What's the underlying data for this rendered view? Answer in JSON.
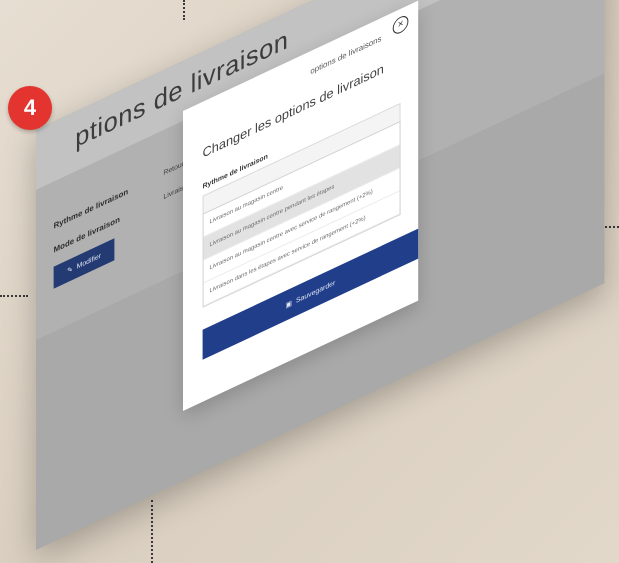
{
  "badge": {
    "number": "4"
  },
  "page": {
    "title": "ptions de livraison",
    "shipping_rhythm_label": "Rythme de livraison",
    "delivery_mode_label": "Mode de livraison",
    "rhythm_value": "Retour",
    "mode_value": "Livraison au magasin",
    "change_button": "Modifier"
  },
  "modal": {
    "subtitle": "options de livraisons",
    "title": "Changer les options de livraison",
    "field_label": "Rythme de livraison",
    "options": [
      "Livraison au magasin centre",
      "Livraison au magasin centre pendant les étapes",
      "Livraison au magasin centre avec service de rangement (+2%)",
      "Livraison dans les étapes avec service de rangement (+2%)"
    ],
    "selected_index": 1,
    "submit_button": "Sauvegarder"
  },
  "colors": {
    "badge": "#e3342f",
    "primary_button": "#213e8b",
    "screen": "#a9a9a9"
  }
}
